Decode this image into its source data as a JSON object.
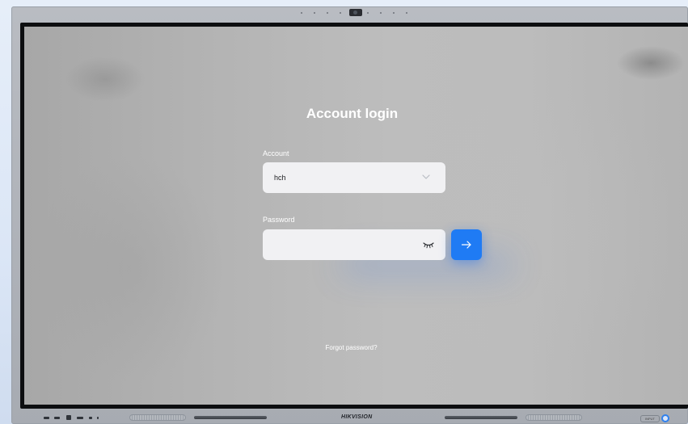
{
  "login": {
    "title": "Account login",
    "account_label": "Account",
    "account_value": "hch",
    "password_label": "Password",
    "password_value": "",
    "forgot_link": "Forgot password?"
  },
  "icons": {
    "account_dropdown": "chevron-down-icon",
    "password_visibility": "eye-closed-icon",
    "submit": "arrow-right-icon",
    "side_panel": "double-chevron-left-icon"
  },
  "device": {
    "brand": "HIKVISION",
    "input_tag": "INPUT"
  },
  "colors": {
    "accent": "#1f7bf4",
    "input_bg": "#f1f1f3",
    "text_light": "#ffffff"
  }
}
